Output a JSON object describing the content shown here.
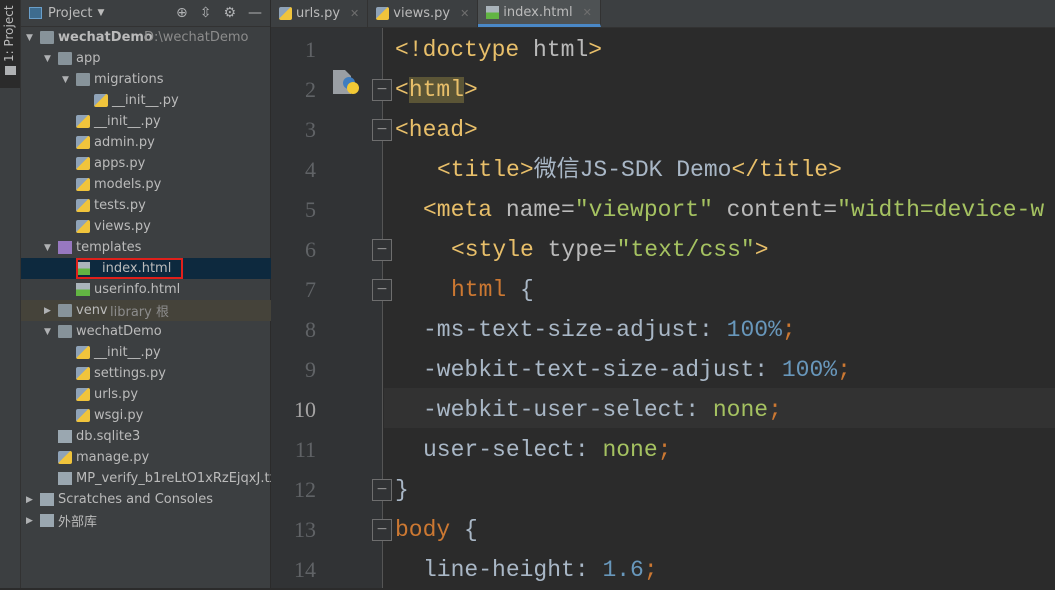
{
  "toolwindow_strip": {
    "label": "1: Project"
  },
  "project_panel": {
    "title": "Project",
    "tree": [
      {
        "label": "wechatDemo",
        "hint": "D:\\wechatDemo",
        "level": 0,
        "type": "module",
        "expanded": true
      },
      {
        "label": "app",
        "level": 1,
        "type": "folder",
        "expanded": true
      },
      {
        "label": "migrations",
        "level": 2,
        "type": "folder",
        "expanded": true
      },
      {
        "label": "__init__.py",
        "level": 3,
        "type": "python"
      },
      {
        "label": "__init__.py",
        "level": 2,
        "type": "python"
      },
      {
        "label": "admin.py",
        "level": 2,
        "type": "python"
      },
      {
        "label": "apps.py",
        "level": 2,
        "type": "python"
      },
      {
        "label": "models.py",
        "level": 2,
        "type": "python"
      },
      {
        "label": "tests.py",
        "level": 2,
        "type": "python"
      },
      {
        "label": "views.py",
        "level": 2,
        "type": "python"
      },
      {
        "label": "templates",
        "level": 1,
        "type": "templates-folder",
        "expanded": true
      },
      {
        "label": "index.html",
        "level": 2,
        "type": "html",
        "selected": true,
        "red_box": true
      },
      {
        "label": "userinfo.html",
        "level": 2,
        "type": "html"
      },
      {
        "label": "venv",
        "hint": "library 根",
        "level": 1,
        "type": "folder",
        "expanded": false,
        "excluded": true
      },
      {
        "label": "wechatDemo",
        "level": 1,
        "type": "folder",
        "expanded": true
      },
      {
        "label": "__init__.py",
        "level": 2,
        "type": "python"
      },
      {
        "label": "settings.py",
        "level": 2,
        "type": "python"
      },
      {
        "label": "urls.py",
        "level": 2,
        "type": "python"
      },
      {
        "label": "wsgi.py",
        "level": 2,
        "type": "python"
      },
      {
        "label": "db.sqlite3",
        "level": 1,
        "type": "text"
      },
      {
        "label": "manage.py",
        "level": 1,
        "type": "python"
      },
      {
        "label": "MP_verify_b1reLtO1xRzEjqxJ.txt",
        "level": 1,
        "type": "text"
      },
      {
        "label": "Scratches and Consoles",
        "level": 0,
        "type": "scratches",
        "expanded": false
      },
      {
        "label": "外部库",
        "level": 0,
        "type": "library",
        "expanded": false
      }
    ]
  },
  "editor": {
    "tabs": [
      {
        "label": "urls.py",
        "icon": "python-file-icon"
      },
      {
        "label": "views.py",
        "icon": "python-file-icon"
      },
      {
        "label": "index.html",
        "icon": "html-file-icon",
        "active": true
      }
    ],
    "current_line": 10,
    "lines": [
      {
        "n": "1",
        "indent": 0,
        "tokens": [
          [
            "t",
            "<!doctype"
          ],
          [
            "a",
            " html"
          ],
          [
            "t",
            ">"
          ]
        ]
      },
      {
        "n": "2",
        "indent": 0,
        "fold": "open",
        "tokens": [
          [
            "t",
            "<"
          ],
          [
            "thl",
            "html"
          ],
          [
            "t",
            ">"
          ]
        ]
      },
      {
        "n": "3",
        "indent": 0,
        "fold": "open",
        "tokens": [
          [
            "t",
            "<head>"
          ]
        ]
      },
      {
        "n": "4",
        "indent": 3,
        "tokens": [
          [
            "t",
            "<title>"
          ],
          [
            "",
            "微信JS-SDK Demo"
          ],
          [
            "t",
            "</title>"
          ]
        ]
      },
      {
        "n": "5",
        "indent": 2,
        "tokens": [
          [
            "t",
            "<meta"
          ],
          [
            "a",
            " name="
          ],
          [
            "s",
            "\"viewport\""
          ],
          [
            "a",
            " content="
          ],
          [
            "s",
            "\"width=device-w"
          ]
        ]
      },
      {
        "n": "6",
        "indent": 4,
        "fold": "open",
        "tokens": [
          [
            "t",
            "<style"
          ],
          [
            "a",
            " type="
          ],
          [
            "s",
            "\"text/css\""
          ],
          [
            "t",
            ">"
          ]
        ]
      },
      {
        "n": "7",
        "indent": 4,
        "fold": "open",
        "tokens": [
          [
            "k",
            "html"
          ],
          [
            "",
            " {"
          ]
        ]
      },
      {
        "n": "8",
        "indent": 2,
        "tokens": [
          [
            "",
            "-ms-text-size-adjust: "
          ],
          [
            "n",
            "100%"
          ],
          [
            "k",
            ";"
          ]
        ]
      },
      {
        "n": "9",
        "indent": 2,
        "tokens": [
          [
            "",
            "-webkit-text-size-adjust: "
          ],
          [
            "n",
            "100%"
          ],
          [
            "k",
            ";"
          ]
        ]
      },
      {
        "n": "10",
        "indent": 2,
        "tokens": [
          [
            "",
            "-webkit-user-select: "
          ],
          [
            "v",
            "none"
          ],
          [
            "k",
            ";"
          ]
        ]
      },
      {
        "n": "11",
        "indent": 2,
        "tokens": [
          [
            "",
            "user-select: "
          ],
          [
            "v",
            "none"
          ],
          [
            "k",
            ";"
          ]
        ]
      },
      {
        "n": "12",
        "indent": 0,
        "fold": "close",
        "tokens": [
          [
            "",
            "}"
          ]
        ]
      },
      {
        "n": "13",
        "indent": 0,
        "fold": "open",
        "tokens": [
          [
            "k",
            "body"
          ],
          [
            "",
            " {"
          ]
        ]
      },
      {
        "n": "14",
        "indent": 2,
        "tokens": [
          [
            "",
            "line-height: "
          ],
          [
            "n",
            "1.6"
          ],
          [
            "k",
            ";"
          ]
        ]
      }
    ]
  },
  "colors": {
    "panel_bg": "#3C3F41",
    "editor_bg": "#2B2B2B",
    "tag": "#E8BF6A",
    "string": "#A5C261",
    "number": "#6897BB",
    "keyword": "#CC7832",
    "selection": "#0D293E",
    "red_box": "#E0201B"
  }
}
